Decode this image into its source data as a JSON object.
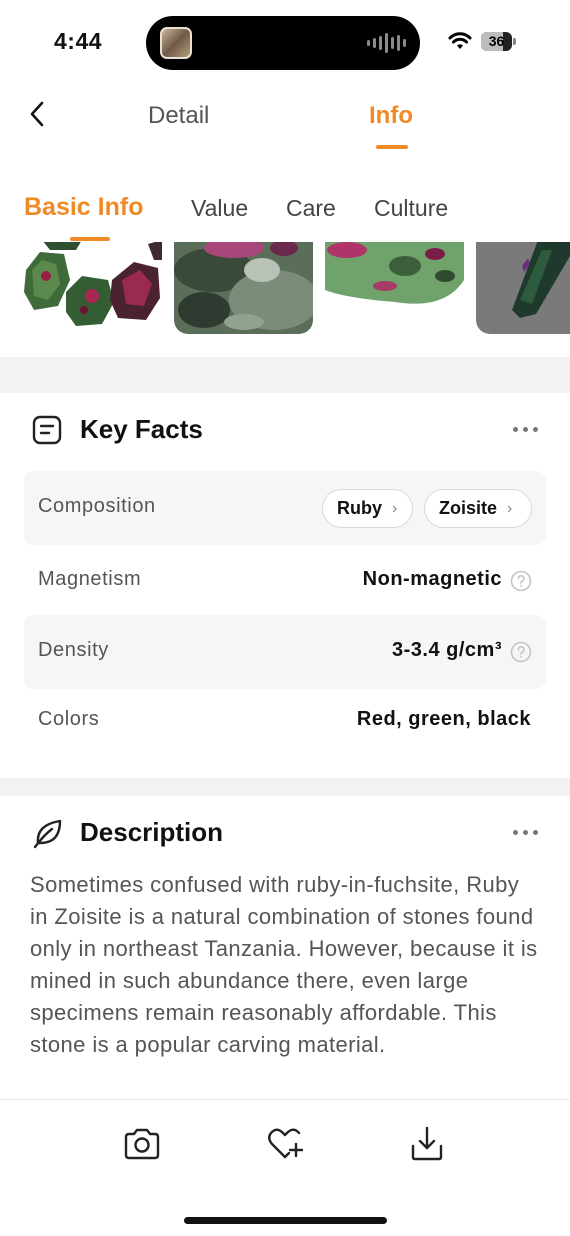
{
  "status_bar": {
    "time": "4:44",
    "battery": "36"
  },
  "nav": {
    "back_icon": "chevron-left-icon",
    "tabs": [
      {
        "label": "Detail",
        "active": false
      },
      {
        "label": "Info",
        "active": true
      }
    ]
  },
  "sub_tabs": [
    {
      "label": "Basic Info",
      "active": true
    },
    {
      "label": "Value",
      "active": false
    },
    {
      "label": "Care",
      "active": false
    },
    {
      "label": "Culture",
      "active": false
    }
  ],
  "key_facts": {
    "title": "Key Facts",
    "icon": "list-card-icon",
    "composition": {
      "label": "Composition",
      "chips": [
        "Ruby",
        "Zoisite"
      ]
    },
    "magnetism": {
      "label": "Magnetism",
      "value": "Non-magnetic"
    },
    "density": {
      "label": "Density",
      "value": "3-3.4 g/cm³"
    },
    "colors": {
      "label": "Colors",
      "value": "Red, green, black"
    }
  },
  "description": {
    "title": "Description",
    "icon": "leaf-icon",
    "text": "Sometimes confused with ruby-in-fuchsite, Ruby in Zoisite is a natural combination of stones found only in northeast Tanzania. However, because it is mined in such abundance there, even large specimens remain reasonably affordable. This stone is a popular carving material."
  },
  "bottom_bar": {
    "icons": [
      "camera-icon",
      "heart-add-icon",
      "download-icon"
    ]
  },
  "colors": {
    "accent": "#f08a24",
    "band": "#f3f2f0"
  }
}
